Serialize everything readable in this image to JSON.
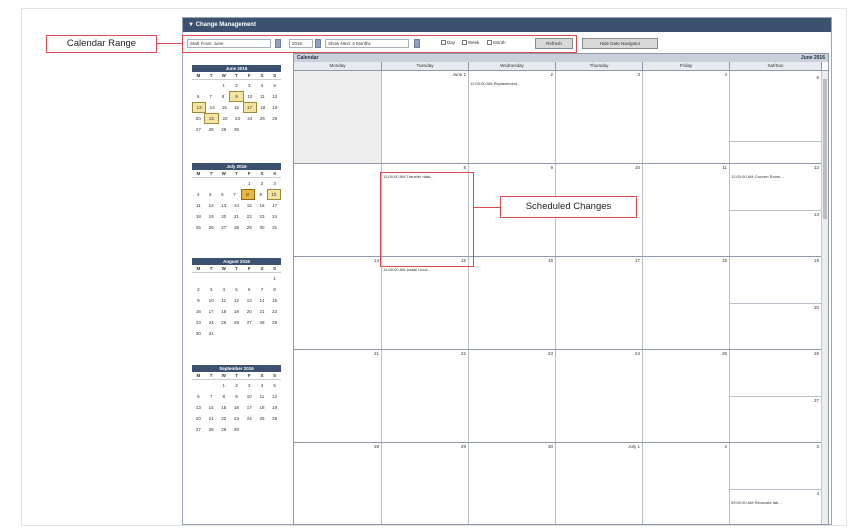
{
  "app": {
    "title": "Change Management"
  },
  "toolbar": {
    "start_from": "Start From: June",
    "year": "2016",
    "show_next": "Show Next: 4 Months",
    "day_label": "Day",
    "week_label": "Week",
    "month_label": "Month",
    "refresh_label": "Refresh",
    "hide_date_navigator_label": "Hide Date Navigator"
  },
  "callouts": {
    "calendar_range": "Calendar Range",
    "scheduled_changes": "Scheduled Changes"
  },
  "mini_calendars": [
    {
      "title": "June 2016",
      "dows": [
        "M",
        "T",
        "W",
        "T",
        "F",
        "S",
        "S"
      ],
      "weeks": [
        [
          "",
          "",
          "1",
          "2",
          "3",
          "4",
          "5"
        ],
        [
          "6",
          "7",
          "8",
          "9",
          "10",
          "11",
          "12"
        ],
        [
          "13",
          "14",
          "15",
          "16",
          "17",
          "18",
          "19"
        ],
        [
          "20",
          "21",
          "22",
          "23",
          "24",
          "25",
          "26"
        ],
        [
          "27",
          "28",
          "29",
          "30",
          "",
          "",
          ""
        ]
      ]
    },
    {
      "title": "July 2016",
      "dows": [
        "M",
        "T",
        "W",
        "T",
        "F",
        "S",
        "S"
      ],
      "weeks": [
        [
          "",
          "",
          "",
          "",
          "1",
          "2",
          "3"
        ],
        [
          "4",
          "5",
          "6",
          "7",
          "8",
          "9",
          "10"
        ],
        [
          "11",
          "12",
          "13",
          "14",
          "15",
          "16",
          "17"
        ],
        [
          "18",
          "19",
          "20",
          "21",
          "22",
          "23",
          "24"
        ],
        [
          "25",
          "26",
          "27",
          "28",
          "29",
          "30",
          "31"
        ]
      ]
    },
    {
      "title": "August 2016",
      "dows": [
        "M",
        "T",
        "W",
        "T",
        "F",
        "S",
        "S"
      ],
      "weeks": [
        [
          "",
          "",
          "",
          "",
          "",
          "",
          "1"
        ],
        [
          "2",
          "3",
          "4",
          "5",
          "6",
          "7",
          "8"
        ],
        [
          "9",
          "10",
          "11",
          "12",
          "13",
          "14",
          "15"
        ],
        [
          "16",
          "17",
          "18",
          "19",
          "20",
          "21",
          "22"
        ],
        [
          "23",
          "24",
          "25",
          "26",
          "27",
          "28",
          "29"
        ],
        [
          "30",
          "31",
          "",
          "",
          "",
          "",
          ""
        ]
      ]
    },
    {
      "title": "September 2016",
      "dows": [
        "M",
        "T",
        "W",
        "T",
        "F",
        "S",
        "S"
      ],
      "weeks": [
        [
          "",
          "",
          "1",
          "2",
          "3",
          "4",
          "5"
        ],
        [
          "6",
          "7",
          "8",
          "9",
          "10",
          "11",
          "12"
        ],
        [
          "13",
          "14",
          "15",
          "16",
          "17",
          "18",
          "19"
        ],
        [
          "20",
          "21",
          "22",
          "23",
          "24",
          "25",
          "26"
        ],
        [
          "27",
          "28",
          "29",
          "30",
          "",
          "",
          ""
        ]
      ]
    }
  ],
  "calendar": {
    "title": "Calendar",
    "month_label": "June 2016",
    "day_headers": [
      "Monday",
      "Tuesday",
      "Wednesday",
      "Thursday",
      "Friday",
      "Sat/Sun"
    ],
    "weeks": [
      {
        "days": [
          "",
          "June 1",
          "2",
          "3",
          "4"
        ],
        "events": [
          "",
          "",
          "12:00:00 AM Replacement...",
          "",
          ""
        ],
        "sat": "",
        "sun": "5",
        "sat_event": "",
        "sun_event": ""
      },
      {
        "days": [
          "",
          "8",
          "9",
          "10",
          "11"
        ],
        "events": [
          "",
          "12:00:00 AM Transfer data...",
          "",
          "",
          ""
        ],
        "sat": "12",
        "sun": "13",
        "sat_event": "12:00:00 AM Concert Room...",
        "sun_event": ""
      },
      {
        "days": [
          "14",
          "15",
          "16",
          "17",
          "18"
        ],
        "events": [
          "",
          "12:00:00 AM Install Linux...",
          "",
          "",
          ""
        ],
        "sat": "19",
        "sun": "20",
        "sat_event": "",
        "sun_event": ""
      },
      {
        "days": [
          "21",
          "22",
          "23",
          "24",
          "25"
        ],
        "events": [
          "",
          "",
          "",
          "",
          ""
        ],
        "sat": "26",
        "sun": "27",
        "sat_event": "",
        "sun_event": ""
      },
      {
        "days": [
          "28",
          "29",
          "30",
          "July 1",
          "2"
        ],
        "events": [
          "",
          "",
          "",
          "",
          ""
        ],
        "sat": "3",
        "sun": "4",
        "sat_event": "",
        "sun_event": "09:00:00 AM Renovate lab..."
      }
    ]
  }
}
